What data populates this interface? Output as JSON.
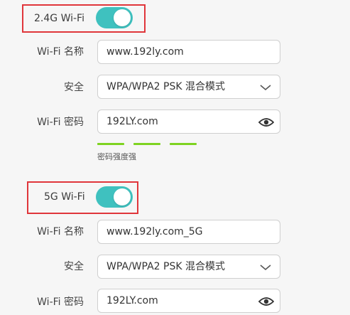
{
  "wifi24": {
    "toggle_label": "2.4G Wi-Fi",
    "enabled": true,
    "name_label": "Wi-Fi 名称",
    "name_value": "www.192ly.com",
    "security_label": "安全",
    "security_value": "WPA/WPA2 PSK 混合模式",
    "password_label": "Wi-Fi 密码",
    "password_value": "192LY.com",
    "strength_text": "密码强度强",
    "strength_bars": 3
  },
  "wifi5": {
    "toggle_label": "5G Wi-Fi",
    "enabled": true,
    "name_label": "Wi-Fi 名称",
    "name_value": "www.192ly.com_5G",
    "security_label": "安全",
    "security_value": "WPA/WPA2 PSK 混合模式",
    "password_label": "Wi-Fi 密码",
    "password_value": "192LY.com"
  },
  "colors": {
    "toggle_on": "#3fc1bf",
    "highlight": "#e0363b",
    "strength": "#7ed321"
  },
  "icons": {
    "dropdown": "chevron-down-icon",
    "reveal_password": "eye-icon"
  }
}
